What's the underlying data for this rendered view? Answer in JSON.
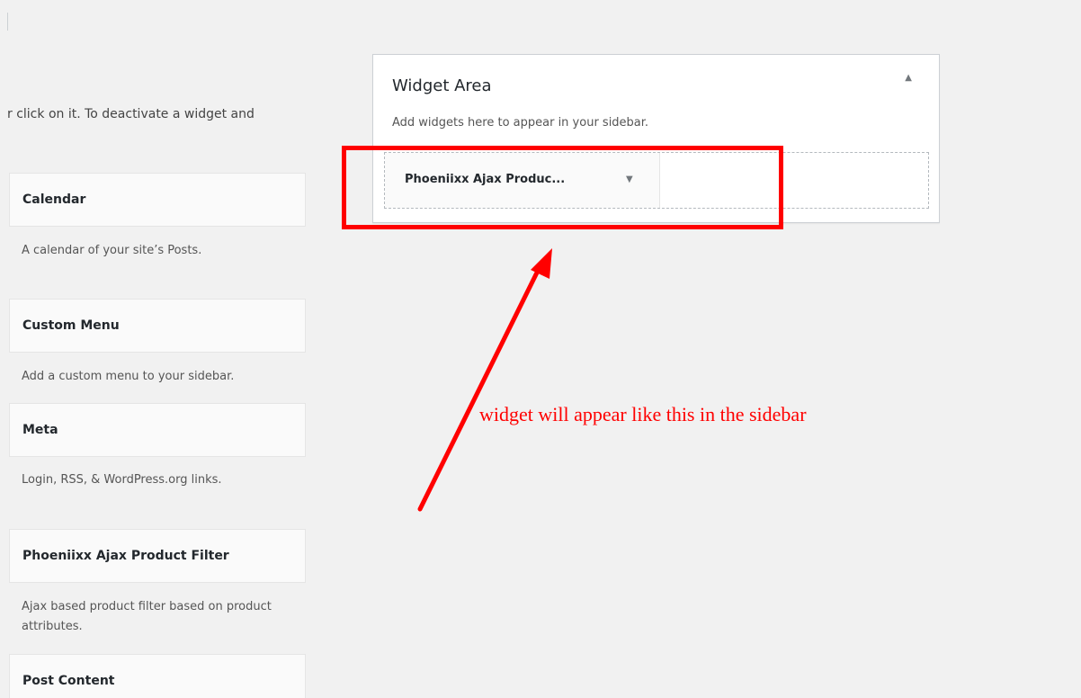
{
  "intro_text": "r click on it. To deactivate a widget and",
  "available_widgets": [
    {
      "title": "Calendar",
      "description": "A calendar of your site’s Posts."
    },
    {
      "title": "Custom Menu",
      "description": "Add a custom menu to your sidebar."
    },
    {
      "title": "Meta",
      "description": "Login, RSS, & WordPress.org links."
    },
    {
      "title": "Phoeniixx Ajax Product Filter",
      "description": "Ajax based product filter based on product attributes."
    },
    {
      "title": "Post Content",
      "description": ""
    }
  ],
  "widget_area": {
    "title": "Widget Area",
    "toggle_icon": "▲",
    "description": "Add widgets here to appear in your sidebar.",
    "placed_widget": {
      "title": "Phoeniixx Ajax Produc...",
      "arrow_icon": "▼"
    }
  },
  "annotation": {
    "text": "widget will appear like this in the sidebar",
    "color": "#ff0000"
  }
}
